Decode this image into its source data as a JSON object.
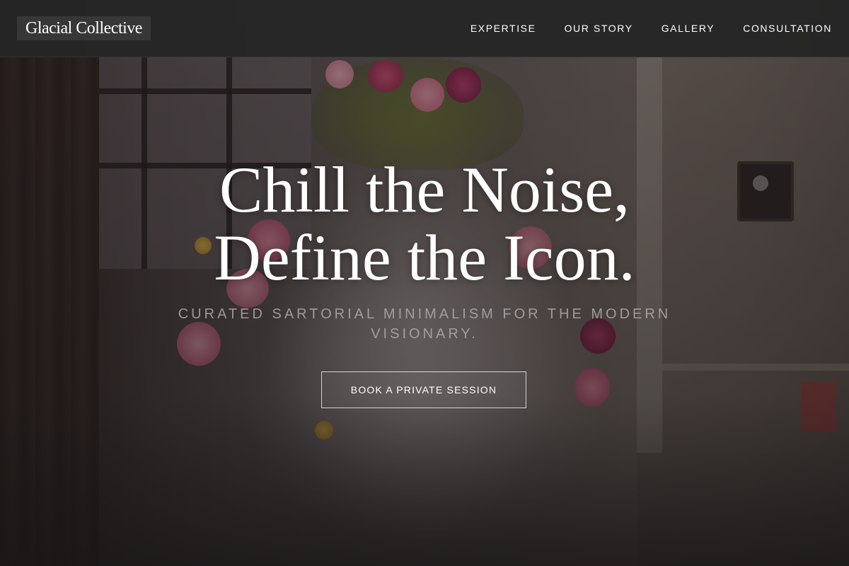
{
  "brand": {
    "name": "Glacial Collective"
  },
  "nav": {
    "items": [
      {
        "label": "EXPERTISE"
      },
      {
        "label": "OUR STORY"
      },
      {
        "label": "GALLERY"
      },
      {
        "label": "CONSULTATION"
      }
    ]
  },
  "hero": {
    "headline_line1": "Chill the Noise,",
    "headline_line2": "Define the Icon.",
    "tagline": "CURATED SARTORIAL MINIMALISM FOR THE MODERN VISIONARY.",
    "cta_label": "BOOK A PRIVATE SESSION",
    "background_image": "floral-dress-mannequin-photo"
  },
  "colors": {
    "nav_background": "#262626",
    "text_primary": "#ffffff",
    "text_muted": "#afaaaa"
  }
}
